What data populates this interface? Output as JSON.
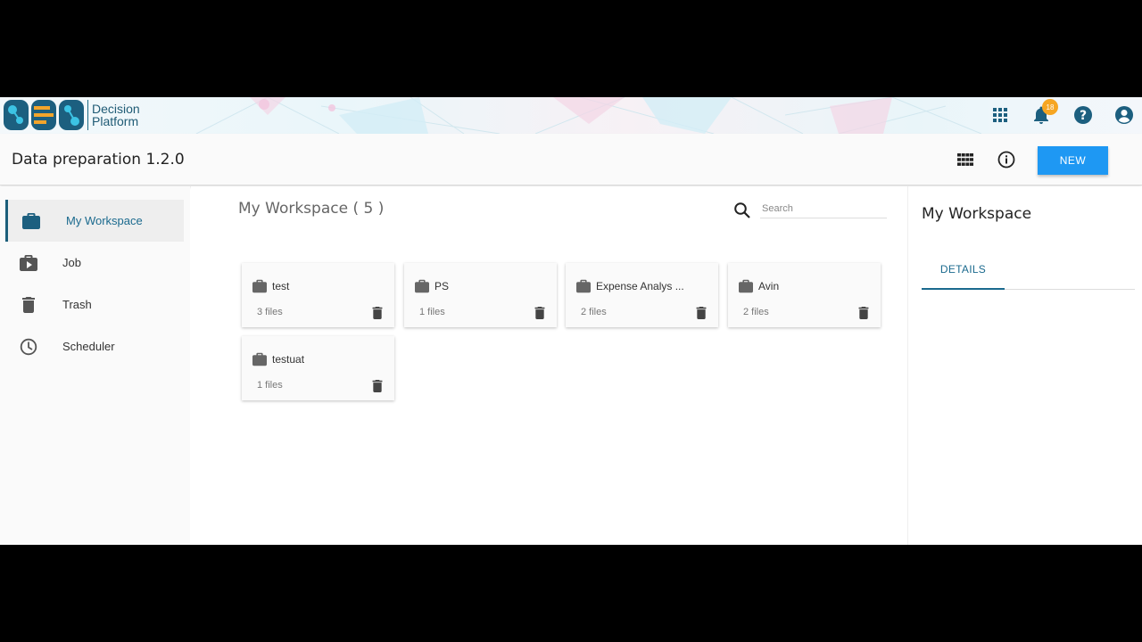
{
  "brand": {
    "name_line1": "Decision",
    "name_line2": "Platform",
    "logo": "BDB-logo"
  },
  "topbar": {
    "icons": [
      "apps-grid-icon",
      "bell-icon",
      "help-icon",
      "account-icon"
    ],
    "notification_count": "18"
  },
  "header": {
    "title": "Data preparation 1.2.0",
    "new_label": "NEW",
    "icons": [
      "grid-view-icon",
      "info-icon"
    ]
  },
  "sidebar": {
    "items": [
      {
        "label": "My Workspace",
        "icon": "briefcase-icon",
        "active": true
      },
      {
        "label": "Job",
        "icon": "job-icon",
        "active": false
      },
      {
        "label": "Trash",
        "icon": "trash-icon",
        "active": false
      },
      {
        "label": "Scheduler",
        "icon": "clock-icon",
        "active": false
      }
    ]
  },
  "main": {
    "title": "My Workspace ( 5 )",
    "search_placeholder": "Search",
    "cards": [
      {
        "name": "test",
        "files": "3 files"
      },
      {
        "name": "PS",
        "files": "1 files"
      },
      {
        "name": "Expense Analys ...",
        "files": "2 files"
      },
      {
        "name": "Avin",
        "files": "2 files"
      },
      {
        "name": "testuat",
        "files": "1 files"
      }
    ]
  },
  "right_panel": {
    "title": "My Workspace",
    "tabs": [
      {
        "label": "DETAILS",
        "active": true
      }
    ]
  },
  "colors": {
    "accent": "#1b6a8e",
    "primary_button": "#1e98f3",
    "badge": "#f6a623"
  }
}
